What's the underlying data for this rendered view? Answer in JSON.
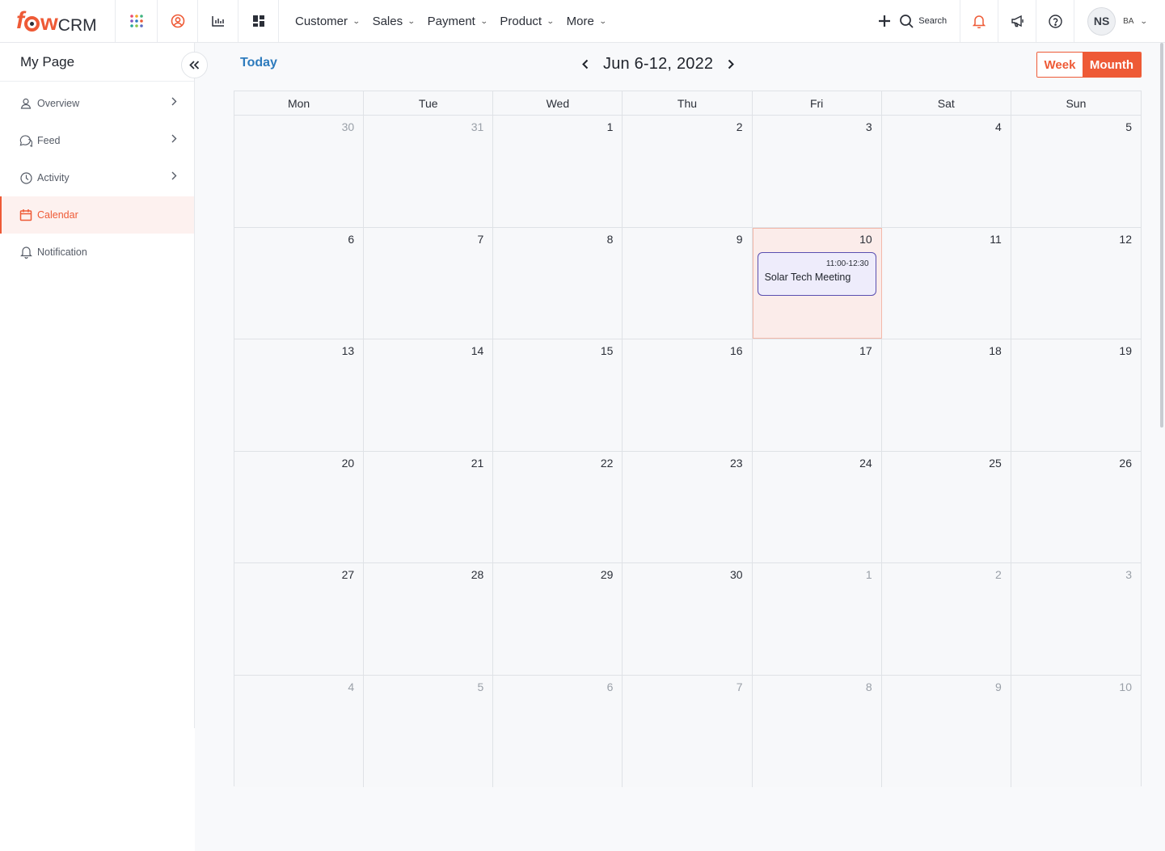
{
  "app": {
    "logo_text": "fowCRM"
  },
  "header": {
    "nav": [
      {
        "label": "Customer"
      },
      {
        "label": "Sales"
      },
      {
        "label": "Payment"
      },
      {
        "label": "Product"
      },
      {
        "label": "More"
      }
    ],
    "search_label": "Search",
    "user_initials": "NS",
    "user_name": "BA"
  },
  "sidebar": {
    "title": "My Page",
    "items": [
      {
        "label": "Overview",
        "icon": "user-icon"
      },
      {
        "label": "Feed",
        "icon": "chat-icon"
      },
      {
        "label": "Activity",
        "icon": "clock-icon"
      },
      {
        "label": "Calendar",
        "icon": "calendar-icon",
        "active": true
      },
      {
        "label": "Notification",
        "icon": "bell-icon"
      }
    ]
  },
  "calendar": {
    "today_label": "Today",
    "title": "Jun 6-12, 2022",
    "view_week": "Week",
    "view_month": "Mounth",
    "weekdays": [
      "Mon",
      "Tue",
      "Wed",
      "Thu",
      "Fri",
      "Sat",
      "Sun"
    ],
    "weeks": [
      [
        {
          "d": "30",
          "m": true
        },
        {
          "d": "31",
          "m": true
        },
        {
          "d": "1"
        },
        {
          "d": "2"
        },
        {
          "d": "3"
        },
        {
          "d": "4"
        },
        {
          "d": "5"
        }
      ],
      [
        {
          "d": "6"
        },
        {
          "d": "7"
        },
        {
          "d": "8"
        },
        {
          "d": "9"
        },
        {
          "d": "10",
          "today": true
        },
        {
          "d": "11"
        },
        {
          "d": "12"
        }
      ],
      [
        {
          "d": "13"
        },
        {
          "d": "14"
        },
        {
          "d": "15"
        },
        {
          "d": "16"
        },
        {
          "d": "17"
        },
        {
          "d": "18"
        },
        {
          "d": "19"
        }
      ],
      [
        {
          "d": "20"
        },
        {
          "d": "21"
        },
        {
          "d": "22"
        },
        {
          "d": "23"
        },
        {
          "d": "24"
        },
        {
          "d": "25"
        },
        {
          "d": "26"
        }
      ],
      [
        {
          "d": "27"
        },
        {
          "d": "28"
        },
        {
          "d": "29"
        },
        {
          "d": "30"
        },
        {
          "d": "1",
          "m": true
        },
        {
          "d": "2",
          "m": true
        },
        {
          "d": "3",
          "m": true
        }
      ],
      [
        {
          "d": "4",
          "m": true
        },
        {
          "d": "5",
          "m": true
        },
        {
          "d": "6",
          "m": true
        },
        {
          "d": "7",
          "m": true
        },
        {
          "d": "8",
          "m": true
        },
        {
          "d": "9",
          "m": true
        },
        {
          "d": "10",
          "m": true
        }
      ]
    ],
    "event": {
      "time": "11:00-12:30",
      "title": "Solar Tech Meeting"
    }
  },
  "colors": {
    "accent": "#ee5a36",
    "link": "#2d7bbd",
    "event_border": "#5a4fb0",
    "event_bg": "#eeecfb"
  }
}
